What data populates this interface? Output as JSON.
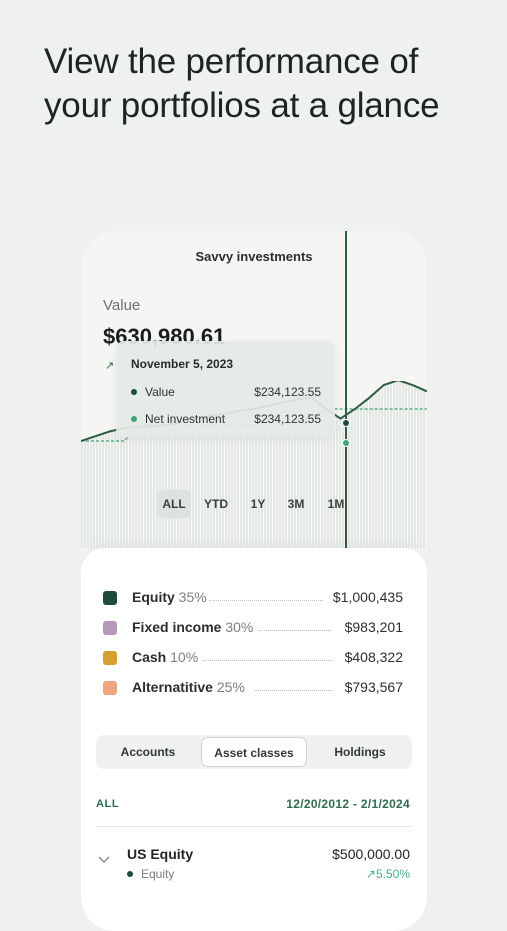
{
  "headline": {
    "line1": "View the performance of",
    "line2": "your portfolios at a glance"
  },
  "app": {
    "title": "Savvy investments"
  },
  "value": {
    "label": "Value",
    "amount": "$630,980.61"
  },
  "tooltip": {
    "date": "November 5, 2023",
    "rows": [
      {
        "label": "Value",
        "amount": "$234,123.55",
        "color": "#1f4b3a"
      },
      {
        "label": "Net investment",
        "amount": "$234,123.55",
        "color": "#3fa37a"
      }
    ]
  },
  "ranges": {
    "items": [
      "ALL",
      "YTD",
      "1Y",
      "3M",
      "1M"
    ],
    "active": "ALL"
  },
  "chart_data": {
    "type": "line",
    "series": [
      {
        "values": [
          0,
          3,
          6,
          8,
          9,
          9,
          10,
          12,
          14,
          16,
          17,
          19,
          20,
          22,
          24,
          26,
          27,
          20,
          14,
          20,
          27,
          35,
          38,
          35,
          31
        ],
        "color": "#2f5c46"
      },
      {
        "values": [
          0,
          0,
          0,
          0,
          10,
          10,
          10,
          10,
          10,
          10,
          10,
          10,
          10,
          14,
          14,
          14,
          14,
          20,
          20,
          20,
          20,
          20,
          20,
          20,
          20
        ],
        "color": "#3fa37a"
      }
    ]
  },
  "allocation": [
    {
      "name": "Equity",
      "pct": "35%",
      "amount": "$1,000,435",
      "color": "#1f4b3a"
    },
    {
      "name": "Fixed income",
      "pct": "30%",
      "amount": "$983,201",
      "color": "#b49ab8"
    },
    {
      "name": "Cash",
      "pct": "10%",
      "amount": "$408,322",
      "color": "#d4a030"
    },
    {
      "name": "Alternatitive",
      "pct": "25%",
      "amount": "$793,567",
      "color": "#eea680"
    }
  ],
  "tabs": {
    "items": [
      "Accounts",
      "Asset classes",
      "Holdings"
    ],
    "active": "Asset classes"
  },
  "filter": {
    "all": "ALL",
    "range": "12/20/2012 - 2/1/2024"
  },
  "holding": {
    "name": "US Equity",
    "class": "Equity",
    "amount": "$500,000.00",
    "change": "5.50%"
  },
  "colors": {
    "accent": "#2f6b4f",
    "positive": "#3fb07f",
    "background": "#eef1ef"
  }
}
